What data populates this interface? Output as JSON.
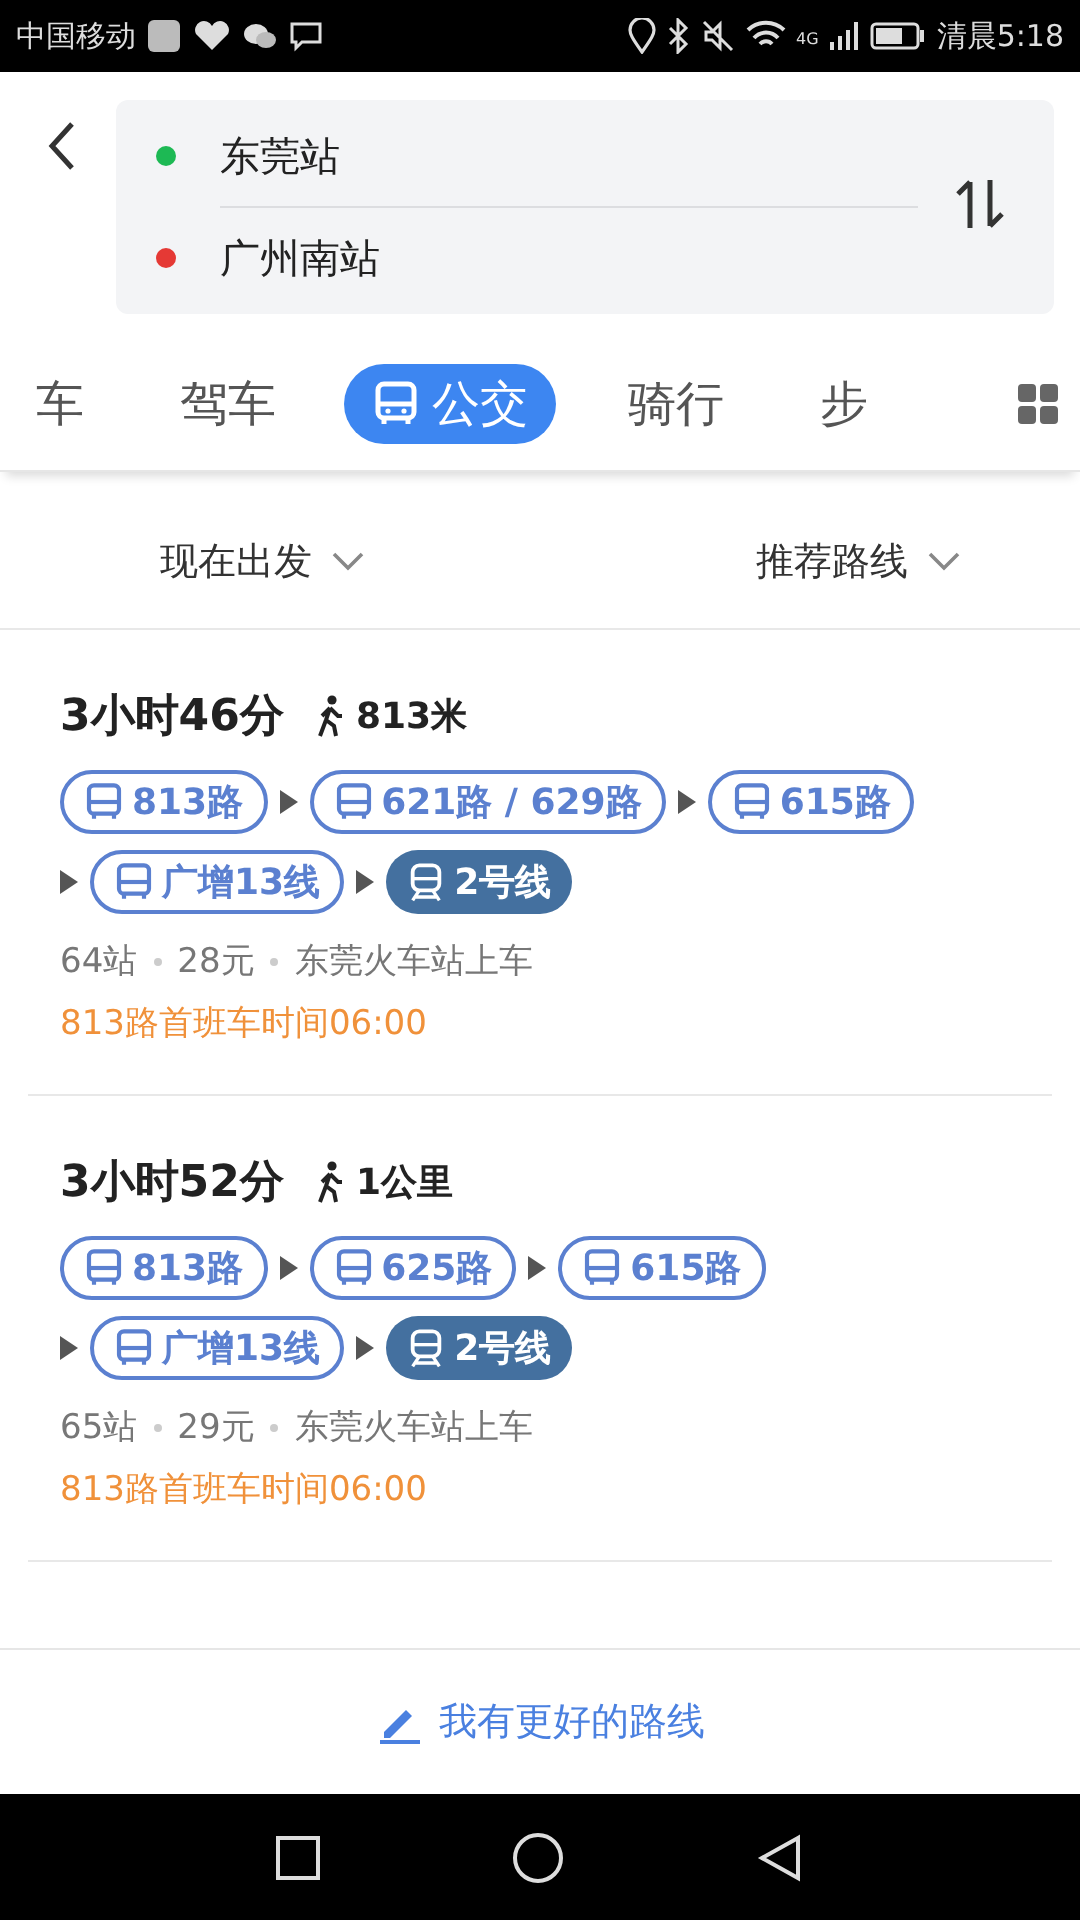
{
  "status_bar": {
    "carrier": "中国移动",
    "network": "4G",
    "time": "清晨5:18"
  },
  "trip": {
    "origin": "东莞站",
    "destination": "广州南站"
  },
  "modes": [
    {
      "label": "车",
      "selected": false
    },
    {
      "label": "驾车",
      "selected": false
    },
    {
      "label": "公交",
      "selected": true
    },
    {
      "label": "骑行",
      "selected": false
    },
    {
      "label": "步",
      "selected": false
    }
  ],
  "filters": [
    "现在出发",
    "推荐路线"
  ],
  "routes": [
    {
      "duration": "3小时46分",
      "walk": "813米",
      "segment_rows": [
        [
          {
            "kind": "bus",
            "label": "813路"
          },
          {
            "kind": "bus",
            "label": "621路 / 629路"
          },
          {
            "kind": "bus",
            "label": "615路"
          }
        ],
        [
          {
            "kind": "bus",
            "label": "广增13线"
          },
          {
            "kind": "subway",
            "label": "2号线"
          }
        ]
      ],
      "stops": "64站",
      "fare": "28元",
      "boarding": "东莞火车站上车",
      "notice": "813路首班车时间06:00"
    },
    {
      "duration": "3小时52分",
      "walk": "1公里",
      "segment_rows": [
        [
          {
            "kind": "bus",
            "label": "813路"
          },
          {
            "kind": "bus",
            "label": "625路"
          },
          {
            "kind": "bus",
            "label": "615路"
          }
        ],
        [
          {
            "kind": "bus",
            "label": "广增13线"
          },
          {
            "kind": "subway",
            "label": "2号线"
          }
        ]
      ],
      "stops": "65站",
      "fare": "29元",
      "boarding": "东莞火车站上车",
      "notice": "813路首班车时间06:00"
    }
  ],
  "feedback": "我有更好的路线"
}
